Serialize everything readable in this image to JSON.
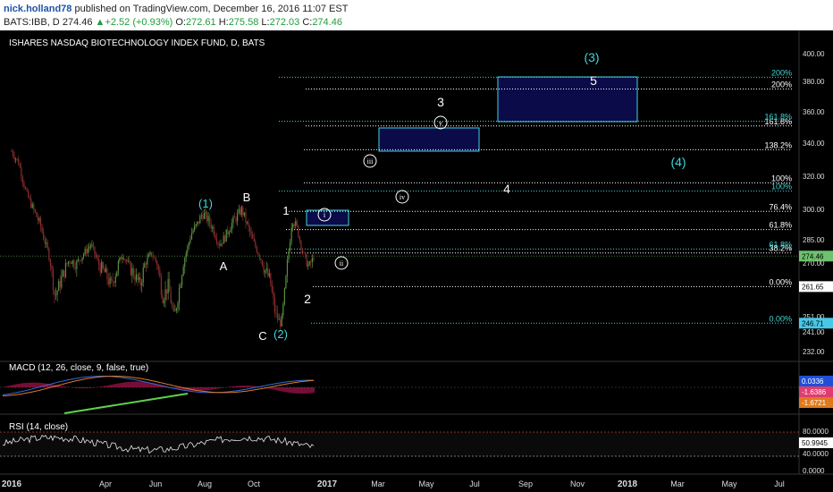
{
  "header": {
    "author": "nick.holland78",
    "published": "published on TradingView.com, December 16, 2016 11:07 EST",
    "symbol": "BATS:IBB, D",
    "last": "274.46",
    "change": "+2.52 (+0.93%)",
    "open_label": "O:",
    "open": "272.61",
    "high_label": "H:",
    "high": "275.58",
    "low_label": "L:",
    "low": "272.03",
    "close_label": "C:",
    "close": "274.46"
  },
  "main_title": "ISHARES NASDAQ BIOTECHNOLOGY INDEX FUND, D, BATS",
  "macd_label": "MACD (12, 26, close, 9, false, true)",
  "rsi_label": "RSI (14, close)",
  "colors": {
    "accent_cyan": "#3fd7d7",
    "box_fill": "#0b0b4a",
    "up_candle": "#5b8f3f",
    "down_candle": "#8b2e2e",
    "macd_line": "#2e6cd8",
    "signal_line": "#e5457a",
    "trend_line": "#5fd14a",
    "rsi_upper": "#c0392b",
    "badge_blue": "#1f4fd6",
    "badge_orange": "#e0791b"
  },
  "chart_data": {
    "type": "candlestick",
    "instrument": "BATS:IBB, D",
    "x_ticks": [
      "2016",
      "Apr",
      "Jun",
      "Aug",
      "Oct",
      "2017",
      "Mar",
      "May",
      "Jul",
      "Sep",
      "Nov",
      "2018",
      "Mar",
      "May",
      "Jul"
    ],
    "price_axis_ticks": [
      "400.00",
      "380.00",
      "360.00",
      "340.00",
      "320.00",
      "300.00",
      "285.00",
      "270.00",
      "251.00",
      "241.00",
      "232.00"
    ],
    "price_badges": [
      {
        "text": "274.46",
        "value": 274.46
      },
      {
        "text": "261.65",
        "value": 261.65
      },
      {
        "text": "246.71",
        "value": 246.71
      }
    ],
    "macd_badges": [
      "0.0336",
      "-1.6386",
      "-1.6721"
    ],
    "rsi_axis_ticks": [
      "80.0000",
      "40.0000",
      "0.0000"
    ],
    "rsi_badge": "50.9945",
    "close_path": [
      [
        "2016-01-01",
        335
      ],
      [
        "2016-01-08",
        328
      ],
      [
        "2016-01-15",
        310
      ],
      [
        "2016-01-22",
        300
      ],
      [
        "2016-01-29",
        292
      ],
      [
        "2016-02-05",
        278
      ],
      [
        "2016-02-12",
        258
      ],
      [
        "2016-02-19",
        265
      ],
      [
        "2016-02-26",
        272
      ],
      [
        "2016-03-04",
        270
      ],
      [
        "2016-03-11",
        276
      ],
      [
        "2016-03-18",
        282
      ],
      [
        "2016-03-25",
        270
      ],
      [
        "2016-04-01",
        266
      ],
      [
        "2016-04-08",
        262
      ],
      [
        "2016-04-15",
        268
      ],
      [
        "2016-04-22",
        276
      ],
      [
        "2016-04-29",
        269
      ],
      [
        "2016-05-06",
        266
      ],
      [
        "2016-05-13",
        262
      ],
      [
        "2016-05-20",
        271
      ],
      [
        "2016-05-27",
        276
      ],
      [
        "2016-06-03",
        270
      ],
      [
        "2016-06-10",
        258
      ],
      [
        "2016-06-17",
        262
      ],
      [
        "2016-06-24",
        250
      ],
      [
        "2016-07-01",
        262
      ],
      [
        "2016-07-08",
        275
      ],
      [
        "2016-07-15",
        288
      ],
      [
        "2016-07-22",
        292
      ],
      [
        "2016-07-29",
        298
      ],
      [
        "2016-08-05",
        295
      ],
      [
        "2016-08-12",
        290
      ],
      [
        "2016-08-19",
        282
      ],
      [
        "2016-08-26",
        286
      ],
      [
        "2016-09-02",
        292
      ],
      [
        "2016-09-09",
        296
      ],
      [
        "2016-09-16",
        300
      ],
      [
        "2016-09-23",
        292
      ],
      [
        "2016-09-30",
        284
      ],
      [
        "2016-10-07",
        276
      ],
      [
        "2016-10-14",
        268
      ],
      [
        "2016-10-21",
        264
      ],
      [
        "2016-10-28",
        252
      ],
      [
        "2016-11-04",
        246
      ],
      [
        "2016-11-11",
        266
      ],
      [
        "2016-11-18",
        296
      ],
      [
        "2016-11-25",
        290
      ],
      [
        "2016-12-02",
        276
      ],
      [
        "2016-12-09",
        268
      ],
      [
        "2016-12-16",
        274.46
      ]
    ],
    "levels": [
      {
        "label": "0.00%",
        "value": 246.71,
        "color": "cyan"
      },
      {
        "label": "0.00%",
        "value": 261.65,
        "color": "white"
      },
      {
        "label": "38.2%",
        "value": 276.5,
        "color": "white"
      },
      {
        "label": "61.8%",
        "value": 279,
        "color": "cyan"
      },
      {
        "label": "61.8%",
        "value": 290,
        "color": "white"
      },
      {
        "label": "76.4%",
        "value": 299,
        "color": "white"
      },
      {
        "label": "100%",
        "value": 311,
        "color": "cyan"
      },
      {
        "label": "100%",
        "value": 316,
        "color": "white"
      },
      {
        "label": "138.2%",
        "value": 336,
        "color": "white"
      },
      {
        "label": "161.8%",
        "value": 351,
        "color": "white"
      },
      {
        "label": "161.8%",
        "value": 354,
        "color": "cyan"
      },
      {
        "label": "200%",
        "value": 375,
        "color": "white"
      },
      {
        "label": "200%",
        "value": 383,
        "color": "cyan"
      }
    ],
    "wave_labels": [
      {
        "text": "(1)",
        "color": "cyan"
      },
      {
        "text": "B",
        "color": "white"
      },
      {
        "text": "A",
        "color": "white"
      },
      {
        "text": "C",
        "color": "white"
      },
      {
        "text": "(2)",
        "color": "cyan"
      },
      {
        "text": "1",
        "color": "white"
      },
      {
        "text": "2",
        "color": "white"
      },
      {
        "text": "i",
        "color": "white",
        "circled": true
      },
      {
        "text": "ii",
        "color": "white",
        "circled": true
      },
      {
        "text": "iii",
        "color": "white",
        "circled": true
      },
      {
        "text": "iv",
        "color": "white",
        "circled": true
      },
      {
        "text": "v",
        "color": "white",
        "circled": true
      },
      {
        "text": "3",
        "color": "white"
      },
      {
        "text": "4",
        "color": "white"
      },
      {
        "text": "5",
        "color": "white"
      },
      {
        "text": "(3)",
        "color": "cyan"
      },
      {
        "text": "(4)",
        "color": "cyan"
      }
    ]
  }
}
